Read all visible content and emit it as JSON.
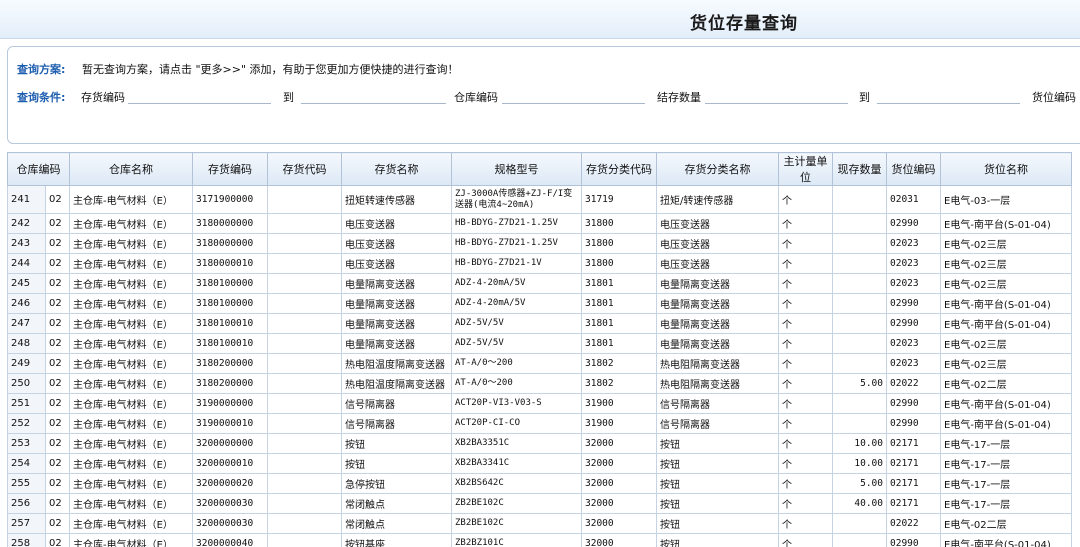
{
  "title": "货位存量查询",
  "query": {
    "plan_label": "查询方案:",
    "plan_hint": "暂无查询方案，请点击 \"更多>>\" 添加，有助于您更加方便快捷的进行查询！",
    "cond_label": "查询条件:",
    "conds": [
      {
        "label": "存货编码"
      },
      {
        "label": "到"
      },
      {
        "label": "仓库编码"
      },
      {
        "label": "结存数量"
      },
      {
        "label": "到"
      },
      {
        "label": "货位编码"
      }
    ]
  },
  "columns": [
    "仓库编码",
    "仓库名称",
    "存货编码",
    "存货代码",
    "存货名称",
    "规格型号",
    "存货分类代码",
    "存货分类名称",
    "主计量单位",
    "现存数量",
    "货位编码",
    "货位名称"
  ],
  "rows": [
    {
      "n": "241",
      "wh": "02",
      "whn": "主仓库-电气材料（E）",
      "code": "3171900000",
      "inv": "",
      "name": "扭矩转速传感器",
      "spec": "ZJ-3000A传感器+ZJ-F/I变送器(电流4~20mA)",
      "cls": "31719",
      "clsn": "扭矩/转速传感器",
      "unit": "个",
      "qty": "",
      "loc": "02031",
      "locn": "E电气-03-一层"
    },
    {
      "n": "242",
      "wh": "02",
      "whn": "主仓库-电气材料（E）",
      "code": "3180000000",
      "inv": "",
      "name": "电压变送器",
      "spec": "HB-BDYG-Z7D21-1.25V",
      "cls": "31800",
      "clsn": "电压变送器",
      "unit": "个",
      "qty": "",
      "loc": "02990",
      "locn": "E电气-南平台(S-01-04)"
    },
    {
      "n": "243",
      "wh": "02",
      "whn": "主仓库-电气材料（E）",
      "code": "3180000000",
      "inv": "",
      "name": "电压变送器",
      "spec": "HB-BDYG-Z7D21-1.25V",
      "cls": "31800",
      "clsn": "电压变送器",
      "unit": "个",
      "qty": "",
      "loc": "02023",
      "locn": "E电气-02三层"
    },
    {
      "n": "244",
      "wh": "02",
      "whn": "主仓库-电气材料（E）",
      "code": "3180000010",
      "inv": "",
      "name": "电压变送器",
      "spec": "HB-BDYG-Z7D21-1V",
      "cls": "31800",
      "clsn": "电压变送器",
      "unit": "个",
      "qty": "",
      "loc": "02023",
      "locn": "E电气-02三层"
    },
    {
      "n": "245",
      "wh": "02",
      "whn": "主仓库-电气材料（E）",
      "code": "3180100000",
      "inv": "",
      "name": "电量隔离变送器",
      "spec": "ADZ-4-20mA/5V",
      "cls": "31801",
      "clsn": "电量隔离变送器",
      "unit": "个",
      "qty": "",
      "loc": "02023",
      "locn": "E电气-02三层"
    },
    {
      "n": "246",
      "wh": "02",
      "whn": "主仓库-电气材料（E）",
      "code": "3180100000",
      "inv": "",
      "name": "电量隔离变送器",
      "spec": "ADZ-4-20mA/5V",
      "cls": "31801",
      "clsn": "电量隔离变送器",
      "unit": "个",
      "qty": "",
      "loc": "02990",
      "locn": "E电气-南平台(S-01-04)"
    },
    {
      "n": "247",
      "wh": "02",
      "whn": "主仓库-电气材料（E）",
      "code": "3180100010",
      "inv": "",
      "name": "电量隔离变送器",
      "spec": "ADZ-5V/5V",
      "cls": "31801",
      "clsn": "电量隔离变送器",
      "unit": "个",
      "qty": "",
      "loc": "02990",
      "locn": "E电气-南平台(S-01-04)"
    },
    {
      "n": "248",
      "wh": "02",
      "whn": "主仓库-电气材料（E）",
      "code": "3180100010",
      "inv": "",
      "name": "电量隔离变送器",
      "spec": "ADZ-5V/5V",
      "cls": "31801",
      "clsn": "电量隔离变送器",
      "unit": "个",
      "qty": "",
      "loc": "02023",
      "locn": "E电气-02三层"
    },
    {
      "n": "249",
      "wh": "02",
      "whn": "主仓库-电气材料（E）",
      "code": "3180200000",
      "inv": "",
      "name": "热电阻温度隔离变送器",
      "spec": "AT-A/0～200",
      "cls": "31802",
      "clsn": "热电阻隔离变送器",
      "unit": "个",
      "qty": "",
      "loc": "02023",
      "locn": "E电气-02三层"
    },
    {
      "n": "250",
      "wh": "02",
      "whn": "主仓库-电气材料（E）",
      "code": "3180200000",
      "inv": "",
      "name": "热电阻温度隔离变送器",
      "spec": "AT-A/0～200",
      "cls": "31802",
      "clsn": "热电阻隔离变送器",
      "unit": "个",
      "qty": "5.00",
      "loc": "02022",
      "locn": "E电气-02二层"
    },
    {
      "n": "251",
      "wh": "02",
      "whn": "主仓库-电气材料（E）",
      "code": "3190000000",
      "inv": "",
      "name": "信号隔离器",
      "spec": "ACT20P-VI3-V03-S",
      "cls": "31900",
      "clsn": "信号隔离器",
      "unit": "个",
      "qty": "",
      "loc": "02990",
      "locn": "E电气-南平台(S-01-04)"
    },
    {
      "n": "252",
      "wh": "02",
      "whn": "主仓库-电气材料（E）",
      "code": "3190000010",
      "inv": "",
      "name": "信号隔离器",
      "spec": "ACT20P-CI-CO",
      "cls": "31900",
      "clsn": "信号隔离器",
      "unit": "个",
      "qty": "",
      "loc": "02990",
      "locn": "E电气-南平台(S-01-04)"
    },
    {
      "n": "253",
      "wh": "02",
      "whn": "主仓库-电气材料（E）",
      "code": "3200000000",
      "inv": "",
      "name": "按钮",
      "spec": "XB2BA3351C",
      "cls": "32000",
      "clsn": "按钮",
      "unit": "个",
      "qty": "10.00",
      "loc": "02171",
      "locn": "E电气-17-一层"
    },
    {
      "n": "254",
      "wh": "02",
      "whn": "主仓库-电气材料（E）",
      "code": "3200000010",
      "inv": "",
      "name": "按钮",
      "spec": "XB2BA3341C",
      "cls": "32000",
      "clsn": "按钮",
      "unit": "个",
      "qty": "10.00",
      "loc": "02171",
      "locn": "E电气-17-一层"
    },
    {
      "n": "255",
      "wh": "02",
      "whn": "主仓库-电气材料（E）",
      "code": "3200000020",
      "inv": "",
      "name": "急停按钮",
      "spec": "XB2BS642C",
      "cls": "32000",
      "clsn": "按钮",
      "unit": "个",
      "qty": "5.00",
      "loc": "02171",
      "locn": "E电气-17-一层"
    },
    {
      "n": "256",
      "wh": "02",
      "whn": "主仓库-电气材料（E）",
      "code": "3200000030",
      "inv": "",
      "name": "常闭触点",
      "spec": "ZB2BE102C",
      "cls": "32000",
      "clsn": "按钮",
      "unit": "个",
      "qty": "40.00",
      "loc": "02171",
      "locn": "E电气-17-一层"
    },
    {
      "n": "257",
      "wh": "02",
      "whn": "主仓库-电气材料（E）",
      "code": "3200000030",
      "inv": "",
      "name": "常闭触点",
      "spec": "ZB2BE102C",
      "cls": "32000",
      "clsn": "按钮",
      "unit": "个",
      "qty": "",
      "loc": "02022",
      "locn": "E电气-02二层"
    },
    {
      "n": "258",
      "wh": "02",
      "whn": "主仓库-电气材料（E）",
      "code": "3200000040",
      "inv": "",
      "name": "按钮基座",
      "spec": "ZB2BZ101C",
      "cls": "32000",
      "clsn": "按钮",
      "unit": "个",
      "qty": "",
      "loc": "02990",
      "locn": "E电气-南平台(S-01-04)"
    }
  ]
}
